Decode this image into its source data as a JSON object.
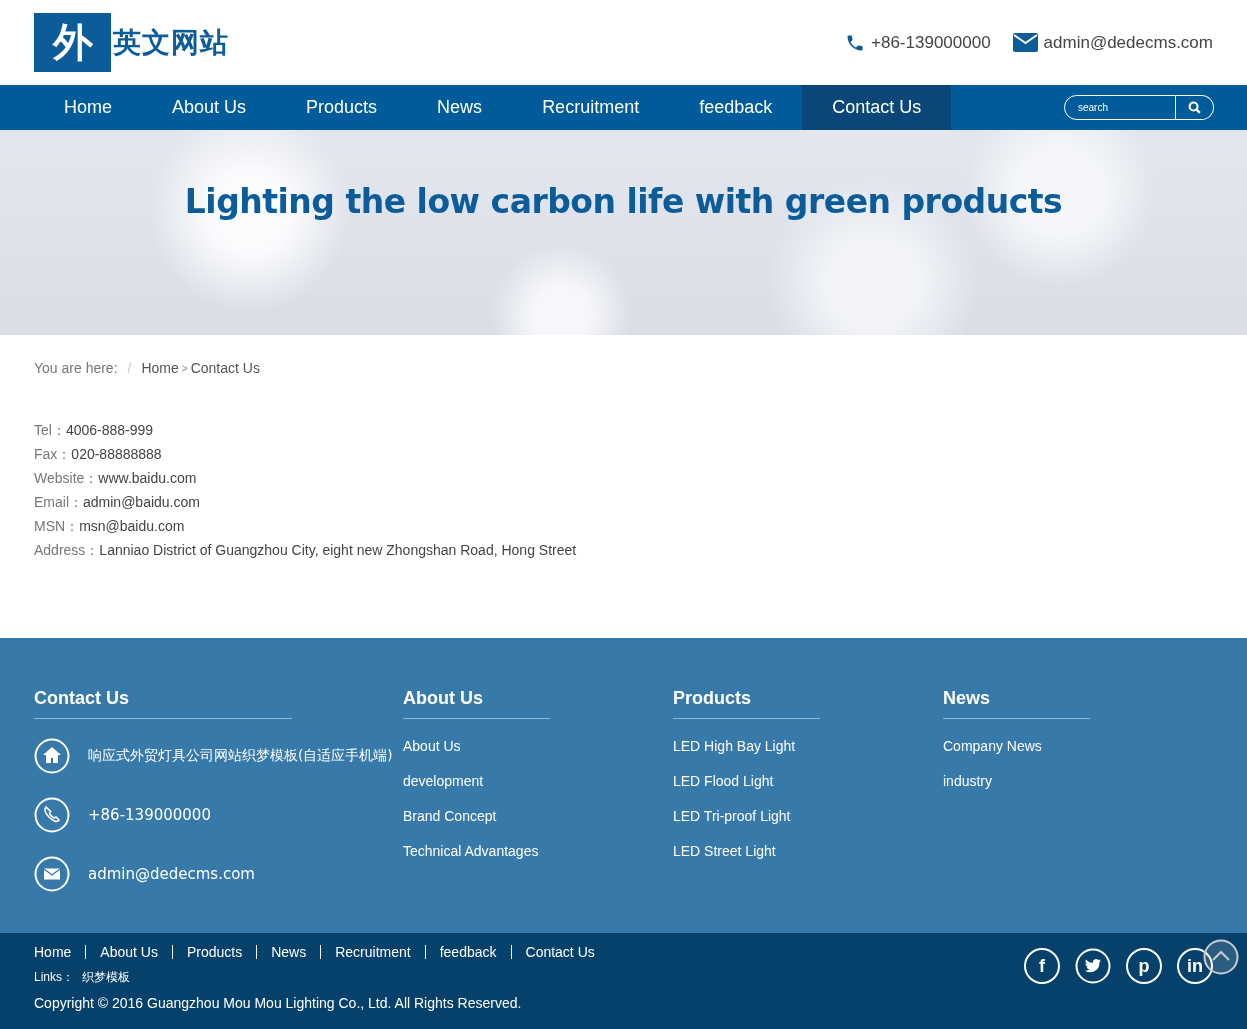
{
  "header": {
    "logo": {
      "mark": "外",
      "text": "英文网站"
    },
    "contacts": [
      {
        "kind": "phone",
        "text": "+86-139000000"
      },
      {
        "kind": "mail",
        "text": "admin@dedecms.com"
      }
    ]
  },
  "nav": {
    "items": [
      {
        "label": "Home",
        "selected": false
      },
      {
        "label": "About Us",
        "selected": false
      },
      {
        "label": "Products",
        "selected": false
      },
      {
        "label": "News",
        "selected": false
      },
      {
        "label": "Recruitment",
        "selected": false
      },
      {
        "label": "feedback",
        "selected": false
      },
      {
        "label": "Contact Us",
        "selected": true
      }
    ],
    "search": {
      "placeholder": "search"
    }
  },
  "hero": {
    "title": "Lighting the low carbon life with green products"
  },
  "breadcrumb": {
    "label": "You are here:",
    "separator": "/",
    "items": [
      "Home",
      "Contact Us"
    ],
    "arrow": ">"
  },
  "contact_info": [
    {
      "label": "Tel：",
      "value": "4006-888-999"
    },
    {
      "label": "Fax：",
      "value": "020-88888888"
    },
    {
      "label": "Website：",
      "value": "www.baidu.com"
    },
    {
      "label": "Email：",
      "value": "admin@baidu.com"
    },
    {
      "label": "MSN：",
      "value": "msn@baidu.com"
    },
    {
      "label": "Address：",
      "value": "Lanniao District of Guangzhou City, eight new Zhongshan Road, Hong Street"
    }
  ],
  "footer": {
    "contact": {
      "title": "Contact Us",
      "items": [
        {
          "kind": "home",
          "text": "响应式外贸灯具公司网站织梦模板(自适应手机端)"
        },
        {
          "kind": "phone",
          "text": "+86-139000000"
        },
        {
          "kind": "mail",
          "text": "admin@dedecms.com"
        }
      ]
    },
    "columns": [
      {
        "title": "About Us",
        "links": [
          "About Us",
          "development",
          "Brand Concept",
          "Technical Advantages"
        ]
      },
      {
        "title": "Products",
        "links": [
          "LED High Bay Light",
          "LED Flood Light",
          "LED Tri-proof Light",
          "LED Street Light"
        ]
      },
      {
        "title": "News",
        "links": [
          "Company News",
          "industry"
        ]
      }
    ]
  },
  "bottom": {
    "links": [
      "Home",
      "About Us",
      "Products",
      "News",
      "Recruitment",
      "feedback",
      "Contact Us"
    ],
    "friend_links": {
      "label": "Links：",
      "items": [
        "织梦模板"
      ]
    },
    "copyright": "Copyright © 2016 Guangzhou Mou Mou Lighting Co., Ltd. All Rights Reserved.",
    "social": [
      {
        "kind": "glyph",
        "glyph": "f"
      },
      {
        "kind": "bird"
      },
      {
        "kind": "glyph",
        "glyph": "p"
      },
      {
        "kind": "glyph",
        "glyph": "in"
      }
    ]
  }
}
